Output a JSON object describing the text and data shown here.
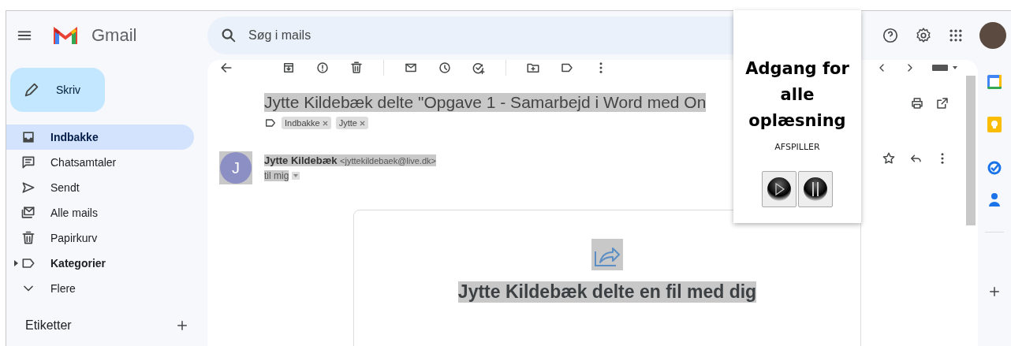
{
  "app": {
    "name": "Gmail"
  },
  "search": {
    "placeholder": "Søg i mails"
  },
  "compose": {
    "label": "Skriv"
  },
  "nav": [
    {
      "label": "Indbakke",
      "selected": true,
      "bold": true,
      "expandable": false
    },
    {
      "label": "Chatsamtaler",
      "selected": false,
      "bold": false,
      "expandable": false
    },
    {
      "label": "Sendt",
      "selected": false,
      "bold": false,
      "expandable": false
    },
    {
      "label": "Alle mails",
      "selected": false,
      "bold": false,
      "expandable": false
    },
    {
      "label": "Papirkurv",
      "selected": false,
      "bold": false,
      "expandable": false
    },
    {
      "label": "Kategorier",
      "selected": false,
      "bold": true,
      "expandable": true
    },
    {
      "label": "Flere",
      "selected": false,
      "bold": false,
      "expandable": false
    }
  ],
  "labels_section": {
    "title": "Etiketter"
  },
  "message": {
    "subject": "Jytte Kildebæk delte \"Opgave 1 - Samarbejd i Word med On",
    "labels": [
      {
        "name": "Indbakke"
      },
      {
        "name": "Jytte"
      }
    ],
    "sender": {
      "initial": "J",
      "name": "Jytte Kildebæk",
      "email": "<jyttekildebaek@live.dk>",
      "to": "til mig"
    }
  },
  "card": {
    "heading": "Jytte Kildebæk delte en fil med dig"
  },
  "popup": {
    "title": "Adgang for alle oplæsning",
    "section": "AFSPILLER"
  }
}
